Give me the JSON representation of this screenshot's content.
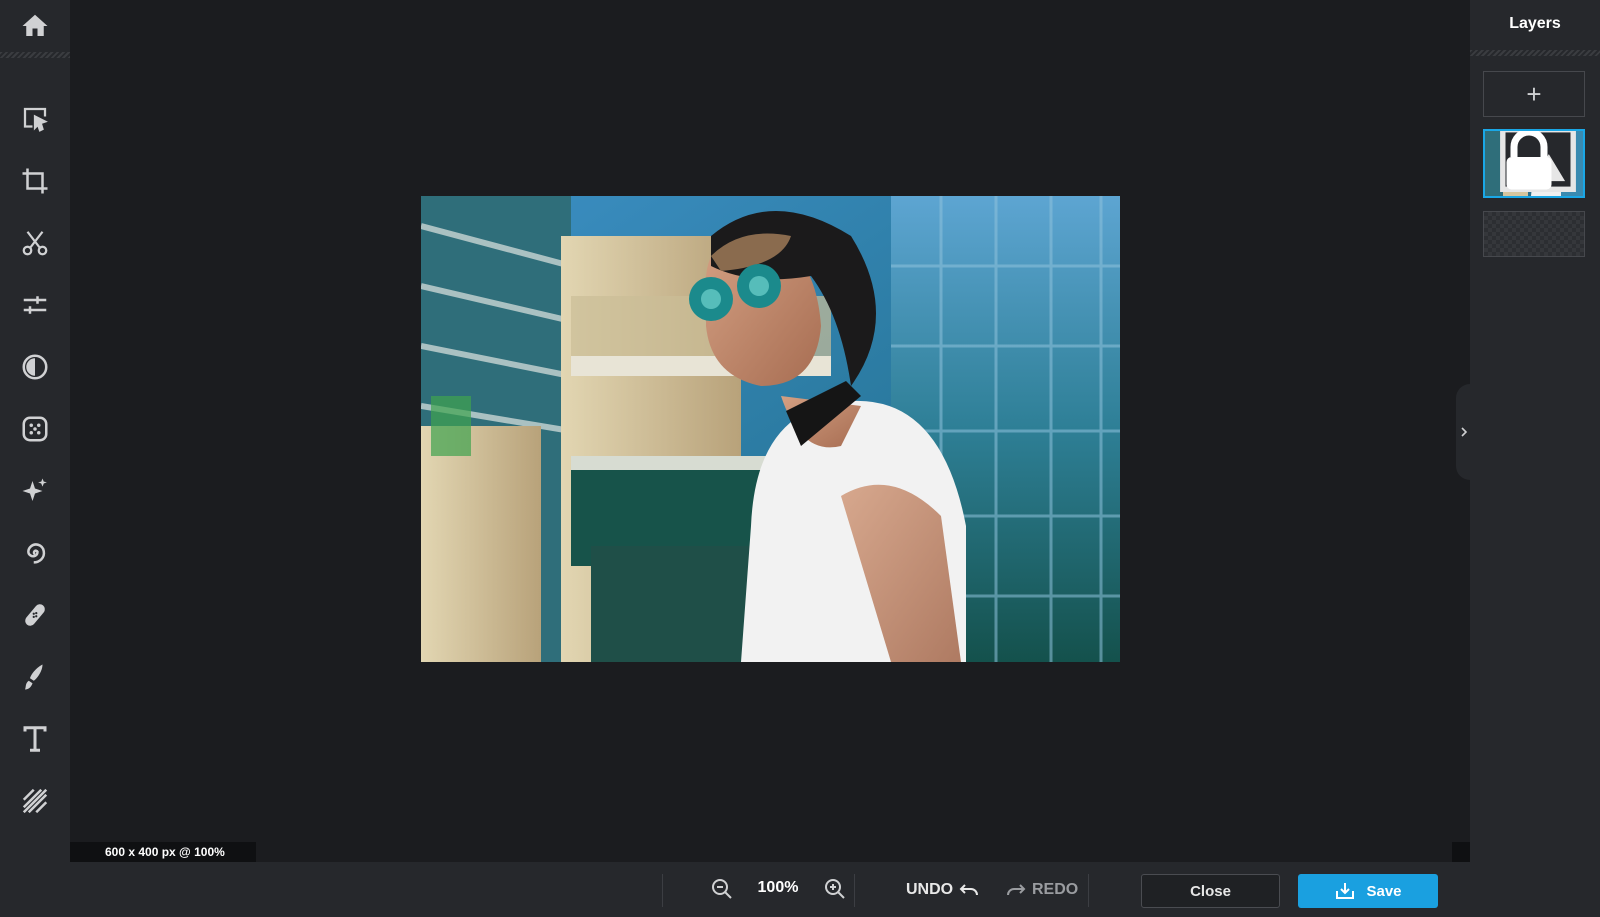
{
  "toolbar": {
    "home_icon": "home-icon",
    "tools": [
      {
        "name": "arrange",
        "icon": "arrange-cursor-icon"
      },
      {
        "name": "crop",
        "icon": "crop-icon"
      },
      {
        "name": "cutout",
        "icon": "scissors-icon"
      },
      {
        "name": "adjust",
        "icon": "sliders-icon"
      },
      {
        "name": "effects",
        "icon": "contrast-icon"
      },
      {
        "name": "filters",
        "icon": "dots-grid-icon"
      },
      {
        "name": "retouch",
        "icon": "sparkle-icon"
      },
      {
        "name": "draw-effects",
        "icon": "swirl-icon"
      },
      {
        "name": "heal",
        "icon": "bandage-icon"
      },
      {
        "name": "brush",
        "icon": "brush-icon"
      },
      {
        "name": "text",
        "icon": "text-icon"
      },
      {
        "name": "texture",
        "icon": "stripes-icon"
      }
    ]
  },
  "canvas": {
    "image_info": "600 x 400 px @ 100%"
  },
  "layers_panel": {
    "title": "Layers",
    "add_symbol": "+",
    "more_symbol": "•••"
  },
  "bottom_bar": {
    "zoom_level": "100%",
    "undo_label": "UNDO",
    "redo_label": "REDO",
    "close_label": "Close",
    "save_label": "Save"
  },
  "colors": {
    "accent": "#1aa0e0",
    "panel": "#26282c",
    "canvas_bg": "#1b1c1f"
  }
}
